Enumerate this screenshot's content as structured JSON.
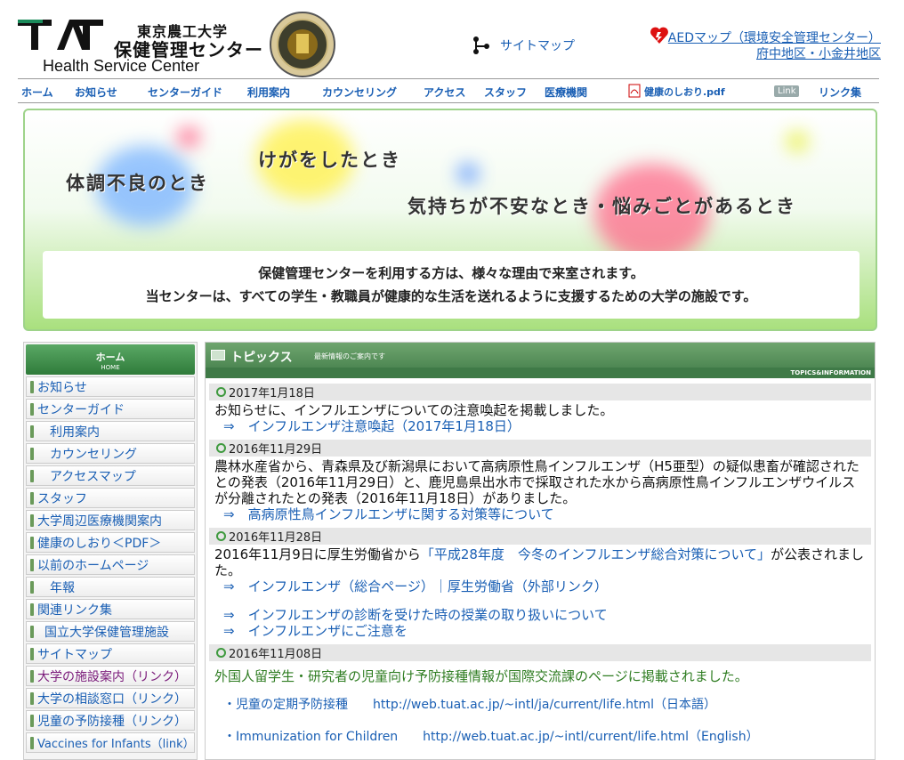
{
  "header": {
    "logo_jp_line1": "東京農工大学",
    "logo_jp_line2": "保健管理センター",
    "logo_en": "Health Service Center",
    "sitemap_label": "サイトマップ",
    "aed_line1": "AEDマップ（環境安全管理センター）",
    "aed_line2": "府中地区・小金井地区"
  },
  "nav": {
    "items": [
      "ホーム",
      "お知らせ",
      "センターガイド",
      "利用案内",
      "カウンセリング",
      "アクセス",
      "スタッフ",
      "医療機関",
      "健康のしおり.pdf",
      "リンク集"
    ],
    "link_badge": "Link"
  },
  "banner": {
    "text1": "体調不良のとき",
    "text2": "けがをしたとき",
    "text3": "気持ちが不安なとき・悩みごとがあるとき",
    "box_line1": "保健管理センターを利用する方は、様々な理由で来室されます。",
    "box_line2": "当センターは、すべての学生・教職員が健康的な生活を送れるように支援するための大学の施設です。"
  },
  "sidebar": {
    "home_label": "ホーム",
    "home_sub": "HOME",
    "items": [
      "お知らせ",
      "センターガイド",
      "利用案内",
      "カウンセリング",
      "アクセスマップ",
      "スタッフ",
      "大学周辺医療機関案内",
      "健康のしおり＜PDF＞",
      "以前のホームページ",
      "年報",
      "関連リンク集",
      "国立大学保健管理施設",
      "サイトマップ",
      "大学の施設案内（リンク）",
      "大学の相談窓口（リンク）",
      "児童の予防接種（リンク）",
      "Vaccines for Infants（link）"
    ]
  },
  "topics": {
    "title": "トピックス",
    "subtitle": "最新情報のご案内です",
    "english": "TOPICS&INFORMATION",
    "entries": [
      {
        "date": "2017年1月18日",
        "text": "お知らせに、インフルエンザについての注意喚起を掲載しました。",
        "links": [
          "⇒　インフルエンザ注意喚起（2017年1月18日）"
        ]
      },
      {
        "date": "2016年11月29日",
        "text": "農林水産省から、青森県及び新潟県において高病原性鳥インフルエンザ（H5亜型）の疑似患畜が確認されたとの発表（2016年11月29日）と、鹿児島県出水市で採取された水から高病原性鳥インフルエンザウイルスが分離されたとの発表（2016年11月18日）がありました。",
        "links": [
          "⇒　高病原性鳥インフルエンザに関する対策等について"
        ]
      },
      {
        "date": "2016年11月28日",
        "text_pre": "2016年11月9日に厚生労働省から",
        "text_link": "「平成28年度　今冬のインフルエンザ総合対策について」",
        "text_post": "が公表されました。",
        "links": [
          "⇒　インフルエンザ（総合ページ）｜厚生労働省（外部リンク）",
          "⇒　インフルエンザの診断を受けた時の授業の取り扱いについて",
          "⇒　インフルエンザにご注意を"
        ]
      },
      {
        "date": "2016年11月08日",
        "text": "外国人留学生・研究者の児童向け予防接種情報が国際交流課のページに掲載されました。",
        "links": [
          "・児童の定期予防接種　　http://web.tuat.ac.jp/~intl/ja/current/life.html（日本語）",
          "・Immunization for Children　　http://web.tuat.ac.jp/~intl/current/life.html（English）"
        ]
      }
    ]
  },
  "colors": {
    "link_blue": "#1a5fb4",
    "header_green": "#3f7a47",
    "banner_border": "#9ed38a",
    "notice_green": "#2f7d22"
  }
}
